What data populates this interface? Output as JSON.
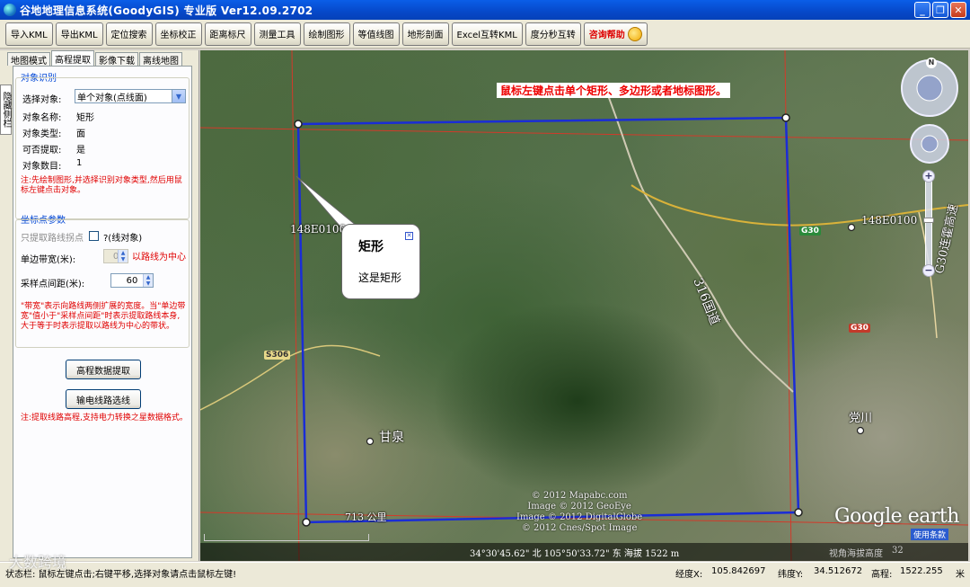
{
  "window": {
    "title": "谷地地理信息系统(GoodyGIS) 专业版 Ver12.09.2702"
  },
  "toolbar": {
    "buttons": [
      "导入KML",
      "导出KML",
      "定位搜索",
      "坐标校正",
      "距离标尺",
      "测量工具",
      "绘制图形",
      "等值线图",
      "地形剖面",
      "Excel互转KML",
      "度分秒互转"
    ],
    "help_label": "咨询帮助"
  },
  "side_tab": {
    "label": "隐藏侧栏"
  },
  "tabs": [
    "地图模式",
    "高程提取",
    "影像下载",
    "离线地图"
  ],
  "object_recog": {
    "title": "对象识别",
    "select_label": "选择对象:",
    "select_value": "单个对象(点线面)",
    "name_label": "对象名称:",
    "name_value": "矩形",
    "type_label": "对象类型:",
    "type_value": "面",
    "extractable_label": "可否提取:",
    "extractable_value": "是",
    "count_label": "对象数目:",
    "count_value": "1",
    "note": "注:先绘制图形,并选择识别对象类型,然后用鼠标左键点击对象。"
  },
  "coord_params": {
    "title": "坐标点参数",
    "only_turning_label": "只提取路线拐点",
    "only_turning_suffix": "?(线对象)",
    "band_width_label": "单边带宽(米):",
    "band_width_value": "0",
    "band_width_suffix": "以路线为中心",
    "sample_interval_label": "采样点间距(米):",
    "sample_interval_value": "60",
    "note": "\"带宽\"表示向路线两侧扩展的宽度。当\"单边带宽\"值小于\"采样点间距\"时表示提取路线本身,大于等于时表示提取以路线为中心的带状。"
  },
  "actions": {
    "extract_button": "高程数据提取",
    "powerline_button": "输电线路选线",
    "note": "注:提取线路高程,支持电力转换之星数据格式。"
  },
  "map": {
    "tip": "鼠标左键点击单个矩形、多边形或者地标图形。",
    "bubble_title": "矩形",
    "bubble_body": "这是矩形",
    "grid_label_left": "148E0100",
    "grid_label_right": "148E0100",
    "place_ganquan": "甘泉",
    "place_dangchuan": "党川",
    "road_s306": "S306",
    "road_g30": "G30",
    "road_g30_badge": "G30",
    "road_316": "316国道",
    "road_g30_expressway": "G30连霍高速",
    "road_713": "713 公里",
    "copyright_lines": [
      "© 2012 Mapabc.com",
      "Image © 2012 GeoEye",
      "Image © 2012 DigitalGlobe",
      "© 2012 Cnes/Spot Image"
    ],
    "logo": "Google earth",
    "terms": "使用条款",
    "coords_readout": "34°30'45.62\" 北 105°50'33.72\" 东 海拔 1522 m",
    "eye_alt": "视角海拔高度",
    "eye_alt_value": "32",
    "compass_n": "N",
    "colors": {
      "rect_border": "#1a2dd6",
      "grid_line": "#d23a2a",
      "road_yellow": "#d9b23a"
    }
  },
  "statusbar": {
    "message": "状态栏: 鼠标左键点击;右键平移,选择对象请点击鼠标左键!",
    "lon_label": "经度X:",
    "lon_value": "105.842697",
    "lat_label": "纬度Y:",
    "lat_value": "34.512672",
    "elev_label": "高程:",
    "elev_value": "1522.255",
    "elev_unit": "米"
  },
  "watermark": "大数跨境"
}
